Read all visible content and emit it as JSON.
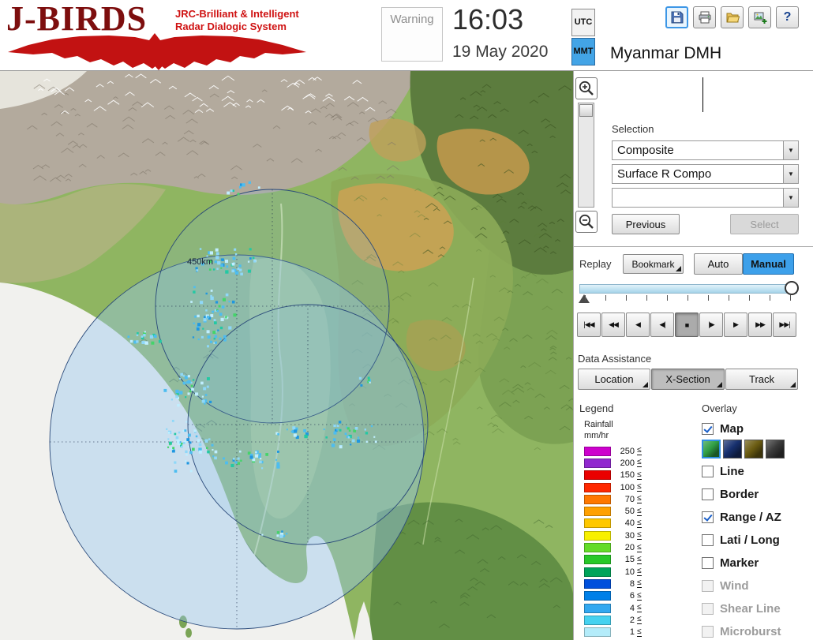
{
  "header": {
    "logo_title": "J-BIRDS",
    "logo_tagline1": "JRC-Brilliant & Intelligent",
    "logo_tagline2": "Radar  Dialogic  System",
    "warning_label": "Warning",
    "clock_time": "16:03",
    "clock_date": "19 May 2020",
    "tz_utc": "UTC",
    "tz_mmt": "MMT",
    "help_glyph": "?"
  },
  "panel": {
    "title": "Myanmar DMH",
    "selection_label": "Selection",
    "combo_composite": "Composite",
    "combo_product": "Surface R Compo",
    "combo_extra": "",
    "previous_button": "Previous",
    "select_button": "Select",
    "replay_label": "Replay",
    "bookmark_button": "Bookmark",
    "auto_button": "Auto",
    "manual_button": "Manual",
    "data_assistance_label": "Data Assistance",
    "location_button": "Location",
    "xsection_button": "X-Section",
    "track_button": "Track",
    "legend_label": "Legend",
    "overlay_label": "Overlay"
  },
  "playback": {
    "buttons": [
      "|◀◀",
      "◀◀",
      "◀",
      "◀|",
      "■",
      "|▶",
      "▶",
      "▶▶",
      "▶▶|"
    ]
  },
  "map": {
    "range_label": "450km"
  },
  "legend": {
    "unit_line1": "Rainfall",
    "unit_line2": "mm/hr",
    "suffix": "≤",
    "entries": [
      {
        "value": "250",
        "color": "#cd00cd"
      },
      {
        "value": "200",
        "color": "#9128cf"
      },
      {
        "value": "150",
        "color": "#ea0000"
      },
      {
        "value": "100",
        "color": "#ff2800"
      },
      {
        "value": "70",
        "color": "#ff7800"
      },
      {
        "value": "50",
        "color": "#ffa000"
      },
      {
        "value": "40",
        "color": "#ffc800"
      },
      {
        "value": "30",
        "color": "#f8f000"
      },
      {
        "value": "20",
        "color": "#64dc28"
      },
      {
        "value": "15",
        "color": "#28c828"
      },
      {
        "value": "10",
        "color": "#00a45a"
      },
      {
        "value": "8",
        "color": "#0050dc"
      },
      {
        "value": "6",
        "color": "#0080e8"
      },
      {
        "value": "4",
        "color": "#32a8f0"
      },
      {
        "value": "2",
        "color": "#46d2f0"
      },
      {
        "value": "1",
        "color": "#b4ecfa"
      }
    ]
  },
  "overlay": {
    "items": [
      {
        "label": "Map",
        "checked": true,
        "enabled": true
      },
      {
        "label": "Line",
        "checked": false,
        "enabled": true
      },
      {
        "label": "Border",
        "checked": false,
        "enabled": true
      },
      {
        "label": "Range / AZ",
        "checked": true,
        "enabled": true
      },
      {
        "label": "Lati / Long",
        "checked": false,
        "enabled": true
      },
      {
        "label": "Marker",
        "checked": false,
        "enabled": true
      },
      {
        "label": "Wind",
        "checked": false,
        "enabled": false
      },
      {
        "label": "Shear Line",
        "checked": false,
        "enabled": false
      },
      {
        "label": "Microburst",
        "checked": false,
        "enabled": false
      }
    ],
    "map_styles": [
      {
        "name": "terrain-green",
        "color": "#2f9e44"
      },
      {
        "name": "navy",
        "color": "#17306e"
      },
      {
        "name": "olive",
        "color": "#6b5c12"
      },
      {
        "name": "dark-gray",
        "color": "#3a3a3a"
      }
    ]
  }
}
